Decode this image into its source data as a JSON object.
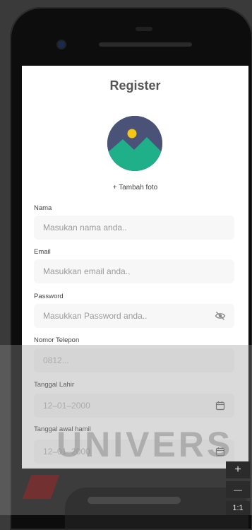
{
  "screen": {
    "title": "Register",
    "add_photo": "+ Tambah foto"
  },
  "form": {
    "nama": {
      "label": "Nama",
      "placeholder": "Masukan nama anda.."
    },
    "email": {
      "label": "Email",
      "placeholder": "Masukkan email anda.."
    },
    "password": {
      "label": "Password",
      "placeholder": "Masukkan Password anda..",
      "icon": "eye-off-icon"
    },
    "telepon": {
      "label": "Nomor Telepon",
      "placeholder": "0812..."
    },
    "tanggal_lahir": {
      "label": "Tanggal Lahir",
      "value": "12–01–2000",
      "icon": "calendar-icon"
    },
    "tanggal_hamil": {
      "label": "Tanggal awal hamil",
      "value": "12–01–2000",
      "icon": "calendar-icon"
    }
  },
  "emulator": {
    "zoom_in": "+",
    "zoom_out": "—",
    "zoom_reset": "1:1"
  },
  "watermark": {
    "text": "UNIVERS"
  },
  "colors": {
    "avatar_bg": "#4a5277",
    "avatar_mountain": "#1fb08a",
    "avatar_sun": "#f5c518"
  }
}
